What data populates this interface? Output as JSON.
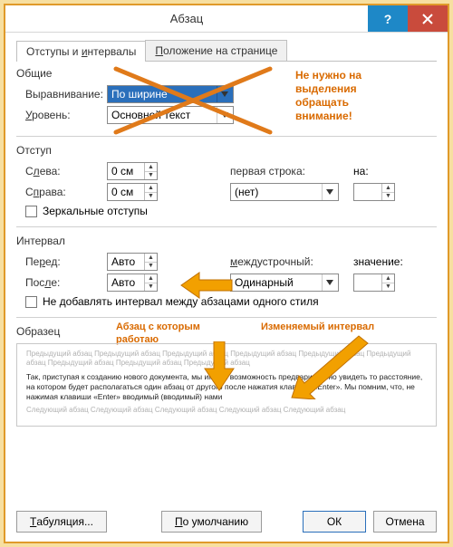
{
  "window": {
    "title": "Абзац",
    "help": "?",
    "close": "×"
  },
  "tabs": {
    "indents": {
      "pre": "Отступы и ",
      "ul": "и",
      "post": "нтервалы",
      "full": "Отступы и интервалы"
    },
    "position": {
      "ul": "П",
      "rest": "оложение на странице"
    }
  },
  "general": {
    "label": "Общие",
    "alignment_label": "Выравнивание:",
    "alignment_value": "По ширине",
    "level_label": "Уровень:",
    "level_ul": "У",
    "level_rest": "ровень:",
    "level_value": "Основной текст",
    "annot": "Не нужно на\nвыделения\nобращать\nвнимание!"
  },
  "indent": {
    "label": "Отступ",
    "left_ul": "л",
    "left_pre": "С",
    "left_post": "ева:",
    "left_value": "0 см",
    "right_ul": "п",
    "right_pre": "С",
    "right_post": "рава:",
    "right_value": "0 см",
    "first_label": "первая строка:",
    "first_value": "(нет)",
    "by_ul": "н",
    "by_post": "а:",
    "by_value": "",
    "mirror_ul": "З",
    "mirror_rest": "еркальные отступы"
  },
  "spacing": {
    "label": "Интервал",
    "before_ul": "р",
    "before_pre": "Пе",
    "before_post": "ед:",
    "before_value": "Авто",
    "after_ul": "л",
    "after_pre": "Пос",
    "after_post": "е:",
    "after_value": "Авто",
    "line_ul": "м",
    "line_rest": "еждустрочный:",
    "line_value": "Одинарный",
    "val_ul": "з",
    "val_rest": "начение:",
    "val_value": "",
    "dont_add": "Не добавлять интервал между абзацами одного стиля"
  },
  "sample": {
    "label": "Образец",
    "annot_left": "Абзац с которым\nработаю",
    "annot_right": "Изменяемый интервал",
    "grey": "Предыдущий абзац Предыдущий абзац Предыдущий абзац Предыдущий абзац Предыдущий абзац Предыдущий абзац Предыдущий абзац Предыдущий абзац Предыдущий абзац",
    "dark": "Так, приступая к созданию нового документа, мы имеем возможность предварительно увидеть то расстояние, на котором будет располагаться один абзац от другого после нажатия клавиши «Enter». Мы помним, что, не нажимая клавиши «Enter» вводимый (вводимый) нами",
    "grey2": "Следующий абзац Следующий абзац Следующий абзац Следующий абзац Следующий абзац"
  },
  "footer": {
    "tabs_ul": "Т",
    "tabs_rest": "абуляция...",
    "default_ul": "П",
    "default_rest": "о умолчанию",
    "ok": "ОК",
    "cancel": "Отмена"
  }
}
